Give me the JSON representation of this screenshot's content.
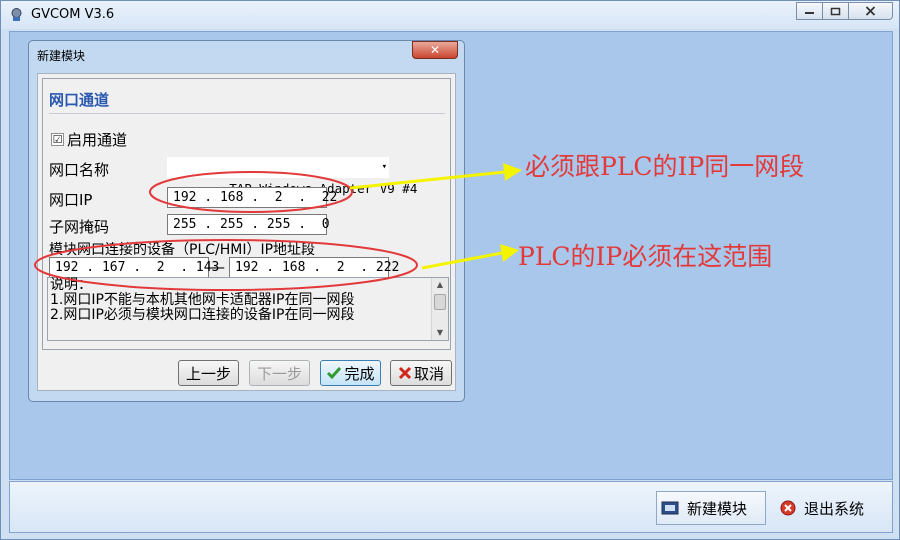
{
  "window": {
    "title": "GVCOM  V3.6",
    "minimize_icon": "minimize-icon",
    "maximize_icon": "maximize-icon",
    "close_icon": "close-icon"
  },
  "statusbar": {
    "new_module_label": "新建模块",
    "new_module_icon": "module-icon",
    "exit_label": "退出系统",
    "exit_icon": "exit-icon"
  },
  "dialog": {
    "title": "新建模块",
    "close_glyph": "✕",
    "section_title": "网口通道",
    "enable_label": "启用通道",
    "enable_checked": true,
    "check_glyph": "☑",
    "port_name_label": "网口名称",
    "port_name_value": "TAP-Windows Adapter V9 #4",
    "dropdown_glyph": "▾",
    "port_ip_label": "网口IP",
    "port_ip_value": "192 . 168 .  2  .  22",
    "subnet_label": "子网掩码",
    "subnet_value": "255 . 255 . 255 .  0",
    "range_label": "模块网口连接的设备（PLC/HMI）IP地址段",
    "range_start": "192 . 167 .  2  . 143",
    "range_dash": "—",
    "range_end": "192 . 168 .  2  . 222",
    "description_lines": [
      "说明：",
      "1.网口IP不能与本机其他网卡适配器IP在同一网段",
      "2.网口IP必须与模块网口连接的设备IP在同一网段"
    ],
    "buttons": {
      "prev": "上一步",
      "next": "下一步",
      "finish": "完成",
      "cancel": "取消"
    },
    "finish_icon": "checkmark-icon",
    "cancel_icon": "cross-icon"
  },
  "annotations": {
    "note1": "必须跟PLC的IP同一网段",
    "note2": "PLC的IP必须在这范围",
    "color": "#e23a3a",
    "arrow_color": "#f4f400"
  }
}
